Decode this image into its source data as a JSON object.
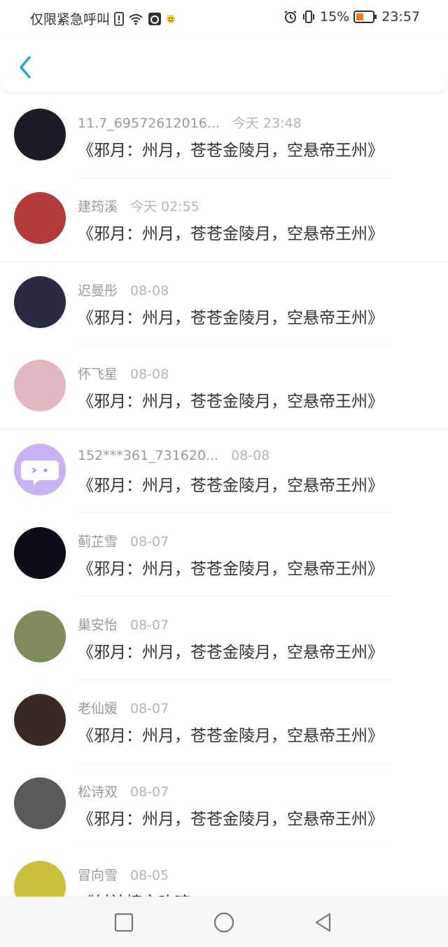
{
  "status_bar": {
    "carrier_text": "仅限紧急呼叫",
    "battery_percent": "15%",
    "time": "23:57"
  },
  "header": {
    "back_icon": "chevron-left-icon"
  },
  "list": [
    {
      "name": "11.7_69572612016...",
      "time": "今天 23:48",
      "message": "《邪月：州月，苍苍金陵月，空悬帝王州》",
      "avatar_color": "#1c1c24"
    },
    {
      "name": "建筠溪",
      "time": "今天 02:55",
      "message": "《邪月：州月，苍苍金陵月，空悬帝王州》",
      "avatar_color": "#b33b3b"
    },
    {
      "name": "迟曼彤",
      "time": "08-08",
      "message": "《邪月：州月，苍苍金陵月，空悬帝王州》",
      "avatar_color": "#2a2a40"
    },
    {
      "name": "怀飞星",
      "time": "08-08",
      "message": "《邪月：州月，苍苍金陵月，空悬帝王州》",
      "avatar_color": "#e3b7c1"
    },
    {
      "name": "152***361_731620...",
      "time": "08-08",
      "message": "《邪月：州月，苍苍金陵月，空悬帝王州》",
      "avatar_color": "#c9b2f2"
    },
    {
      "name": "蓟芷雪",
      "time": "08-07",
      "message": "《邪月：州月，苍苍金陵月，空悬帝王州》",
      "avatar_color": "#0d0d18"
    },
    {
      "name": "巢安怡",
      "time": "08-07",
      "message": "《邪月：州月，苍苍金陵月，空悬帝王州》",
      "avatar_color": "#7d8c5a"
    },
    {
      "name": "老仙媛",
      "time": "08-07",
      "message": "《邪月：州月，苍苍金陵月，空悬帝王州》",
      "avatar_color": "#3a2a26"
    },
    {
      "name": "松诗双",
      "time": "08-07",
      "message": "《邪月：州月，苍苍金陵月，空悬帝王州》",
      "avatar_color": "#5a5a5a"
    },
    {
      "name": "冒向雪",
      "time": "08-05",
      "message": "《封神榜之叱咤",
      "avatar_color": "#c9c23a"
    }
  ]
}
